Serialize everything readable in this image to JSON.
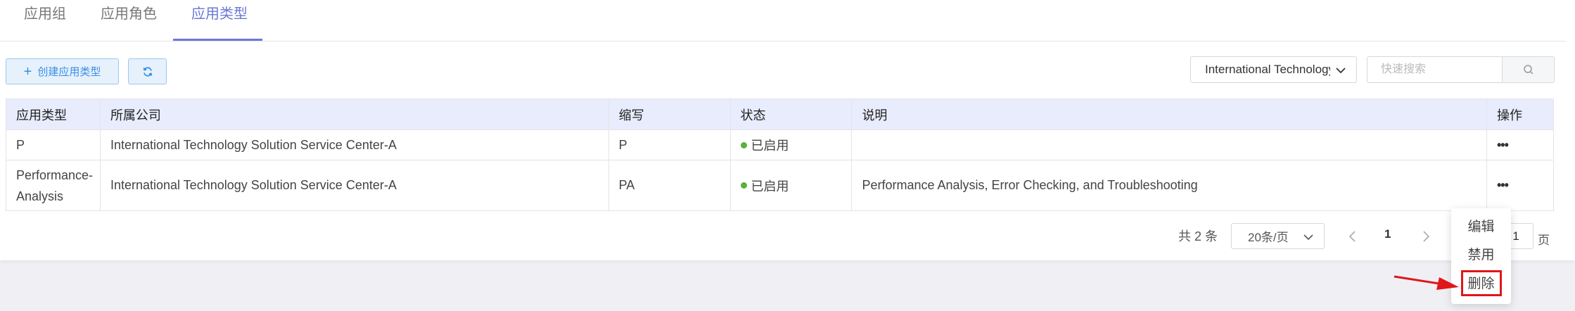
{
  "tabs": [
    {
      "label": "应用组",
      "active": false
    },
    {
      "label": "应用角色",
      "active": false
    },
    {
      "label": "应用类型",
      "active": true
    }
  ],
  "toolbar": {
    "create_label": "创建应用类型",
    "company_select_value": "International Technology Solution Service Center-A",
    "search_placeholder": "快速搜索"
  },
  "table": {
    "headers": [
      "应用类型",
      "所属公司",
      "缩写",
      "状态",
      "说明",
      "操作"
    ],
    "rows": [
      {
        "type": "P",
        "company": "International Technology Solution Service Center-A",
        "abbr": "P",
        "status": "已启用",
        "desc": "",
        "action": "•••"
      },
      {
        "type": "Performance-Analysis",
        "company": "International Technology Solution Service Center-A",
        "abbr": "PA",
        "status": "已启用",
        "desc": "Performance Analysis, Error Checking, and Troubleshooting",
        "action": "•••"
      }
    ]
  },
  "pagination": {
    "total": "共 2 条",
    "page_size": "20条/页",
    "current_page": "1",
    "jump_value": "1",
    "suffix": "页"
  },
  "action_menu": {
    "items": [
      "编辑",
      "禁用",
      "删除"
    ],
    "highlighted": "删除"
  },
  "colors": {
    "accent": "#6b78d8",
    "primary_blue": "#3a8ee6",
    "status_enabled": "#5ab03c",
    "annotation_red": "#e0161b",
    "header_bg": "#e8ecfc"
  },
  "icons": {
    "create": "plus-icon",
    "refresh": "refresh-icon",
    "select": "chevron-down-icon",
    "search": "search-icon",
    "prev": "chevron-left-icon",
    "next": "chevron-right-icon"
  }
}
